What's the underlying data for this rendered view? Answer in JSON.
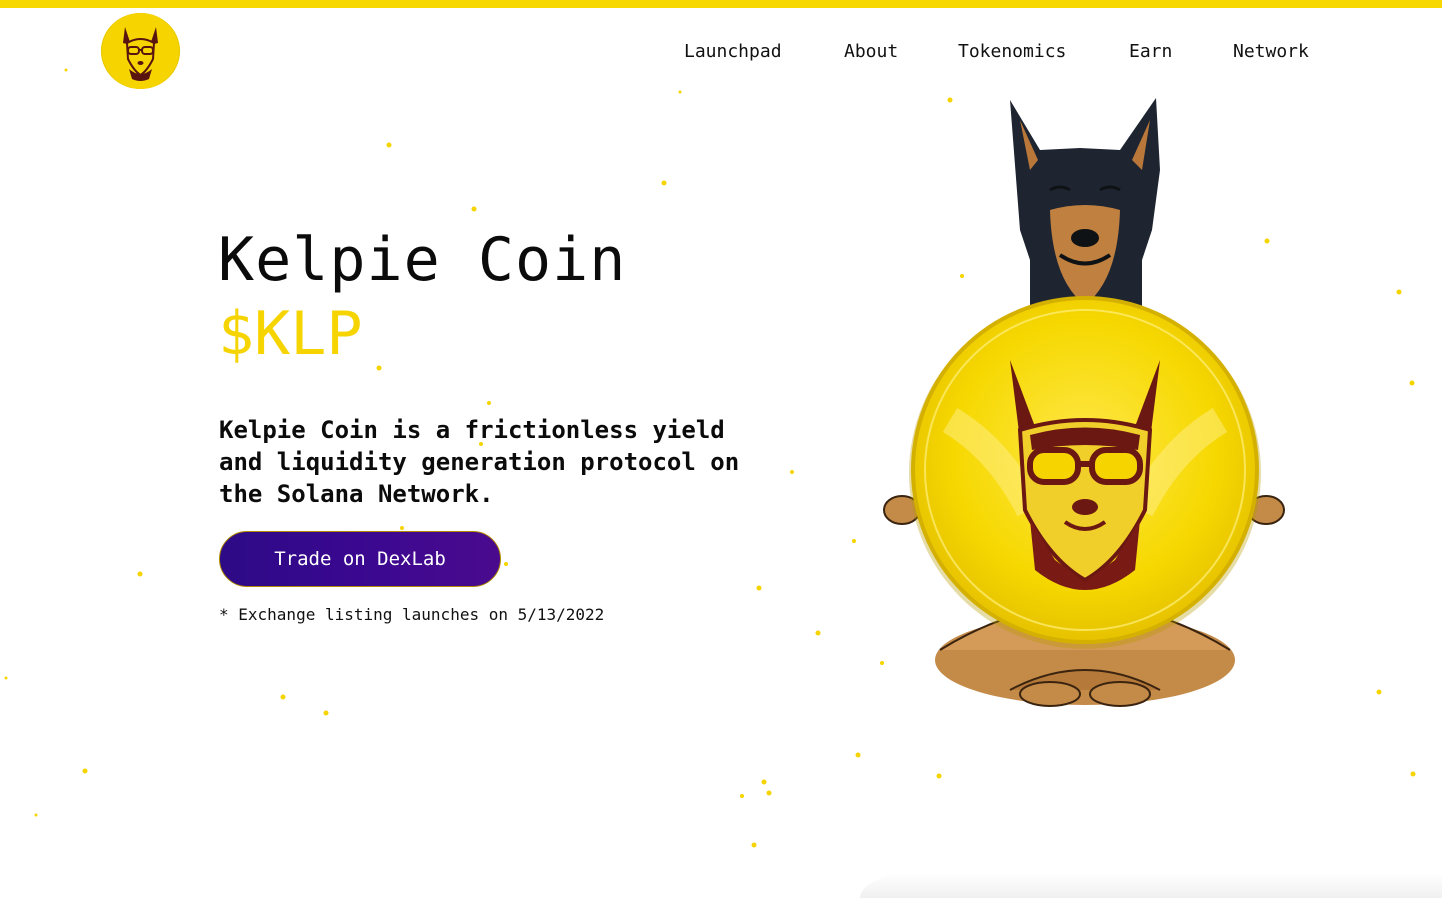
{
  "header": {
    "logo_icon": "kelpie-dog-goggles-logo-icon",
    "nav": [
      {
        "label": "Launchpad"
      },
      {
        "label": "About"
      },
      {
        "label": "Tokenomics"
      },
      {
        "label": "Earn"
      },
      {
        "label": "Network"
      }
    ]
  },
  "hero": {
    "title": "Kelpie Coin",
    "ticker": "$KLP",
    "description": "Kelpie Coin is a frictionless yield and liquidity generation protocol on the Solana Network.",
    "cta_label": "Trade on DexLab",
    "note": "* Exchange listing launches on 5/13/2022",
    "mascot_icon": "meditating-kelpie-dog-with-coin-icon"
  },
  "colors": {
    "accent": "#f7d800",
    "ticker": "#f5d400",
    "button": "#2d0a86",
    "text": "#0b0b0b"
  }
}
